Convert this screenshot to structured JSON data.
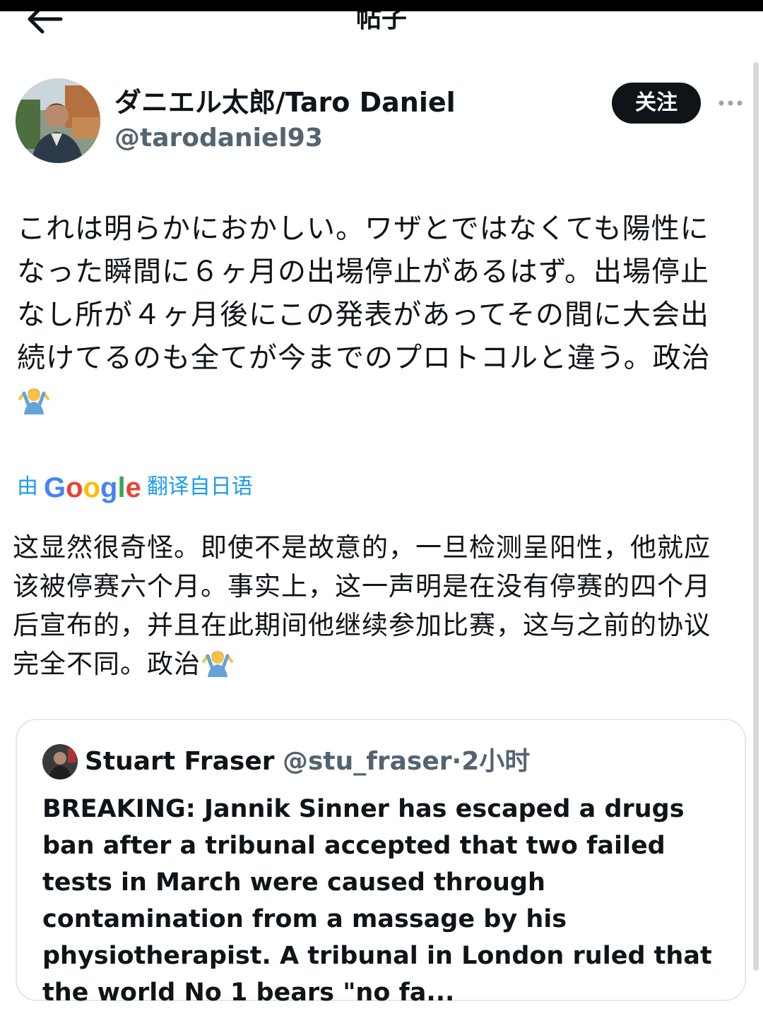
{
  "header": {
    "title": "帖子",
    "back_icon": "arrow-left-icon"
  },
  "author": {
    "display_name": "ダニエル太郎/Taro Daniel",
    "handle": "@tarodaniel93",
    "follow_label": "关注",
    "more_icon": "more-horizontal-icon"
  },
  "tweet": {
    "text": "これは明らかにおかしい。ワザとではなくても陽性になった瞬間に６ヶ月の出場停止があるはず。出場停止なし所が４ヶ月後にこの発表があってその間に大会出続けてるのも全てが今までのプロトコルと違う。政治",
    "emoji": "person-shrugging-emoji"
  },
  "translation": {
    "prefix": "由",
    "provider": "Google",
    "suffix": "翻译自日语",
    "text": "这显然很奇怪。即使不是故意的，一旦检测呈阳性，他就应该被停赛六个月。事实上，这一声明是在没有停赛的四个月后宣布的，并且在此期间他继续参加比赛，这与之前的协议完全不同。政治"
  },
  "quote": {
    "name": "Stuart Fraser",
    "handle": "@stu_fraser",
    "dot": "·",
    "time": "2小时",
    "text": "BREAKING: Jannik Sinner has escaped a drugs ban after a tribunal accepted that two failed tests in March were caused through contamination from a massage by his physiotherapist. A tribunal in London ruled that the world No 1 bears \"no fa..."
  },
  "colors": {
    "link_blue": "#1d9bf0",
    "text": "#0f1419",
    "secondary": "#536471",
    "google_blue": "#4285F4",
    "google_red": "#EA4335",
    "google_yellow": "#FBBC05",
    "google_green": "#34A853"
  }
}
